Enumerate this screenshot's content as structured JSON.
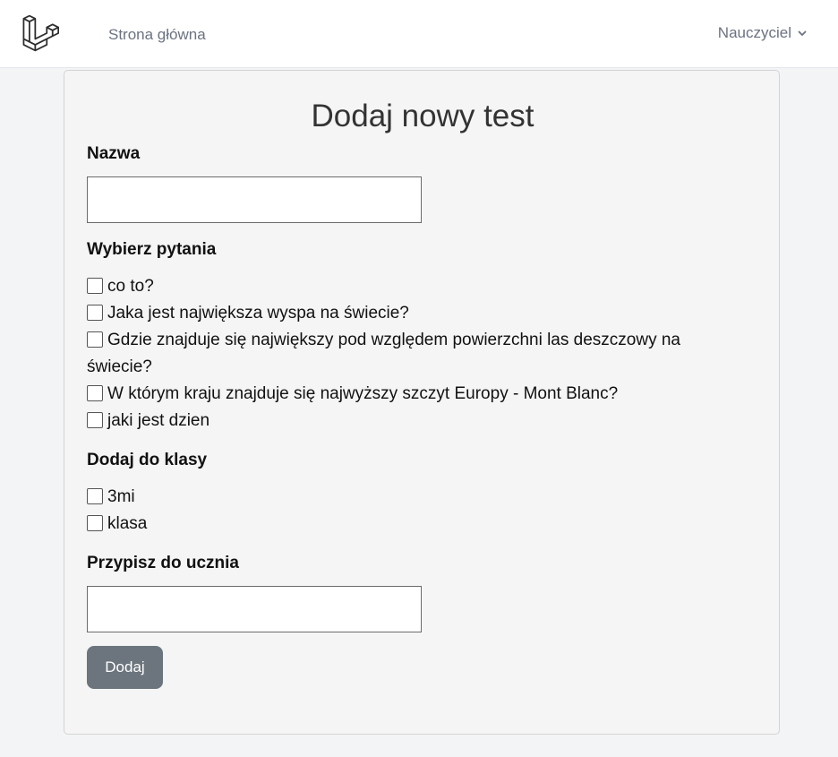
{
  "nav": {
    "home_link": "Strona główna",
    "user_menu": "Nauczyciel"
  },
  "form": {
    "title": "Dodaj nowy test",
    "name_label": "Nazwa",
    "name_value": "",
    "questions_label": "Wybierz pytania",
    "questions": [
      {
        "label": "co to?",
        "checked": false
      },
      {
        "label": "Jaka jest największa wyspa na świecie?",
        "checked": false
      },
      {
        "label": "Gdzie znajduje się największy pod względem powierzchni las deszczowy na świecie?",
        "checked": false
      },
      {
        "label": "W którym kraju znajduje się najwyższy szczyt Europy - Mont Blanc?",
        "checked": false
      },
      {
        "label": "jaki jest dzien",
        "checked": false
      }
    ],
    "classes_label": "Dodaj do klasy",
    "classes": [
      {
        "label": "3mi",
        "checked": false
      },
      {
        "label": "klasa",
        "checked": false
      }
    ],
    "student_label": "Przypisz do ucznia",
    "student_value": "",
    "submit_label": "Dodaj"
  },
  "colors": {
    "button": "#6c757d",
    "nav_text": "#6b7280",
    "logo": "#2d2d2d"
  },
  "icons": {
    "logo": "laravel-logo",
    "dropdown": "chevron-down-icon"
  }
}
